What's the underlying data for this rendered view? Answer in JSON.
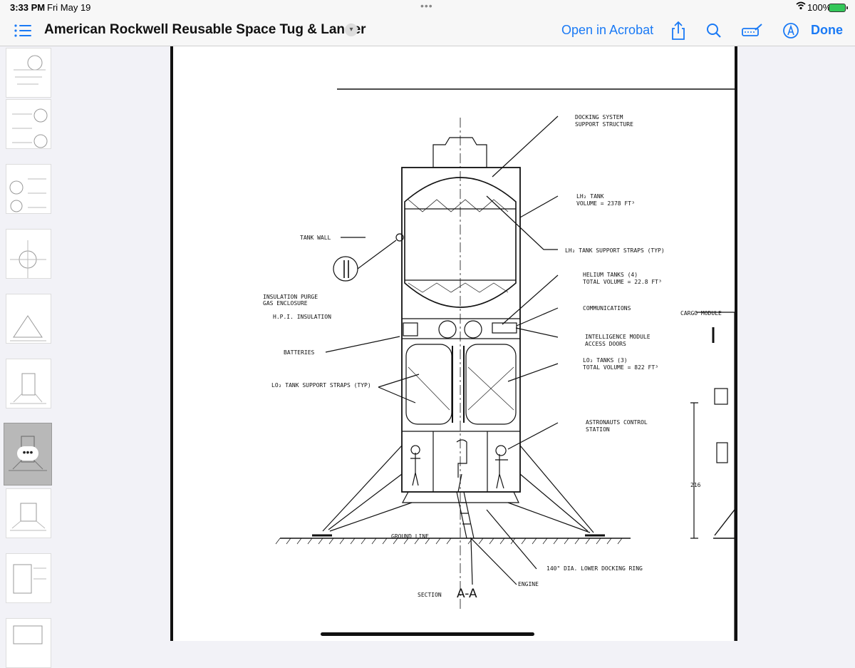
{
  "status": {
    "time": "3:33 PM",
    "date": "Fri May 19",
    "battery": "100%"
  },
  "toolbar": {
    "title": "American Rockwell Reusable Space Tug & Lander",
    "open_in": "Open in Acrobat",
    "done": "Done"
  },
  "icons": [
    "list-icon",
    "chevron-down-icon",
    "share-icon",
    "search-icon",
    "markup-icon",
    "pen-icon",
    "wifi-icon",
    "battery-icon"
  ],
  "drawing": {
    "labels": {
      "docking": [
        "DOCKING SYSTEM",
        "SUPPORT STRUCTURE"
      ],
      "lh2_tank": [
        "LH₂ TANK",
        "VOLUME = 2378 FT³"
      ],
      "lh2_straps": "LH₂ TANK SUPPORT STRAPS (TYP)",
      "tank_wall": "TANK WALL",
      "insulation_purge": [
        "INSULATION PURGE",
        "GAS ENCLOSURE"
      ],
      "hpi": "H.P.I. INSULATION",
      "helium": [
        "HELIUM TANKS (4)",
        "TOTAL VOLUME = 22.8 FT³"
      ],
      "communications": "COMMUNICATIONS",
      "cargo": "CARGO MODULE",
      "intelligence": [
        "INTELLIGENCE MODULE",
        "ACCESS DOORS"
      ],
      "batteries": "BATTERIES",
      "lo2_tanks": [
        "LO₂ TANKS (3)",
        "TOTAL VOLUME = 822 FT³"
      ],
      "lo2_straps": "LO₂ TANK SUPPORT STRAPS (TYP)",
      "astronauts": [
        "ASTRONAUTS CONTROL",
        "STATION"
      ],
      "dim": "216",
      "ground": "GROUND LINE",
      "docking_ring": "140\" DIA. LOWER DOCKING RING",
      "engine": "ENGINE",
      "section": "SECTION",
      "section_id": "A-A"
    }
  }
}
